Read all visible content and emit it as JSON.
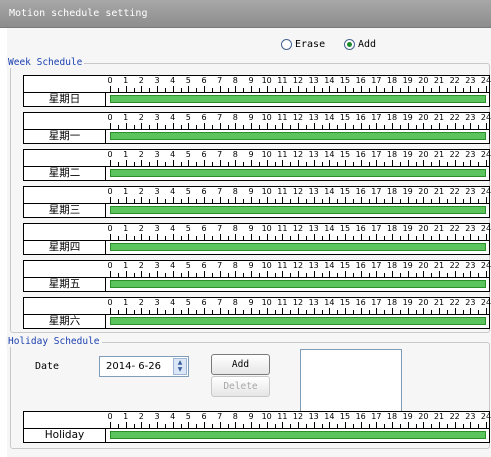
{
  "window": {
    "title": "Motion schedule setting"
  },
  "mode": {
    "erase_label": "Erase",
    "add_label": "Add",
    "selected": "Add"
  },
  "week_schedule": {
    "legend": "Week Schedule",
    "days": [
      {
        "label": "星期日",
        "active_start_hour": 0,
        "active_end_hour": 24
      },
      {
        "label": "星期一",
        "active_start_hour": 0,
        "active_end_hour": 24
      },
      {
        "label": "星期二",
        "active_start_hour": 0,
        "active_end_hour": 24
      },
      {
        "label": "星期三",
        "active_start_hour": 0,
        "active_end_hour": 24
      },
      {
        "label": "星期四",
        "active_start_hour": 0,
        "active_end_hour": 24
      },
      {
        "label": "星期五",
        "active_start_hour": 0,
        "active_end_hour": 24
      },
      {
        "label": "星期六",
        "active_start_hour": 0,
        "active_end_hour": 24
      }
    ]
  },
  "hours": [
    "0",
    "1",
    "2",
    "3",
    "4",
    "5",
    "6",
    "7",
    "8",
    "9",
    "10",
    "11",
    "12",
    "13",
    "14",
    "15",
    "16",
    "17",
    "18",
    "19",
    "20",
    "21",
    "22",
    "23",
    "24"
  ],
  "holiday_schedule": {
    "legend": "Holiday Schedule",
    "date_label": "Date",
    "date_value": "2014- 6-26",
    "add_button": "Add",
    "delete_button": "Delete",
    "row": {
      "label": "Holiday",
      "active_start_hour": 0,
      "active_end_hour": 24
    }
  },
  "colors": {
    "schedule_bar": "#5cc45c",
    "legend_text": "#1a3fb0",
    "title_bar": "#9a9a9a"
  }
}
